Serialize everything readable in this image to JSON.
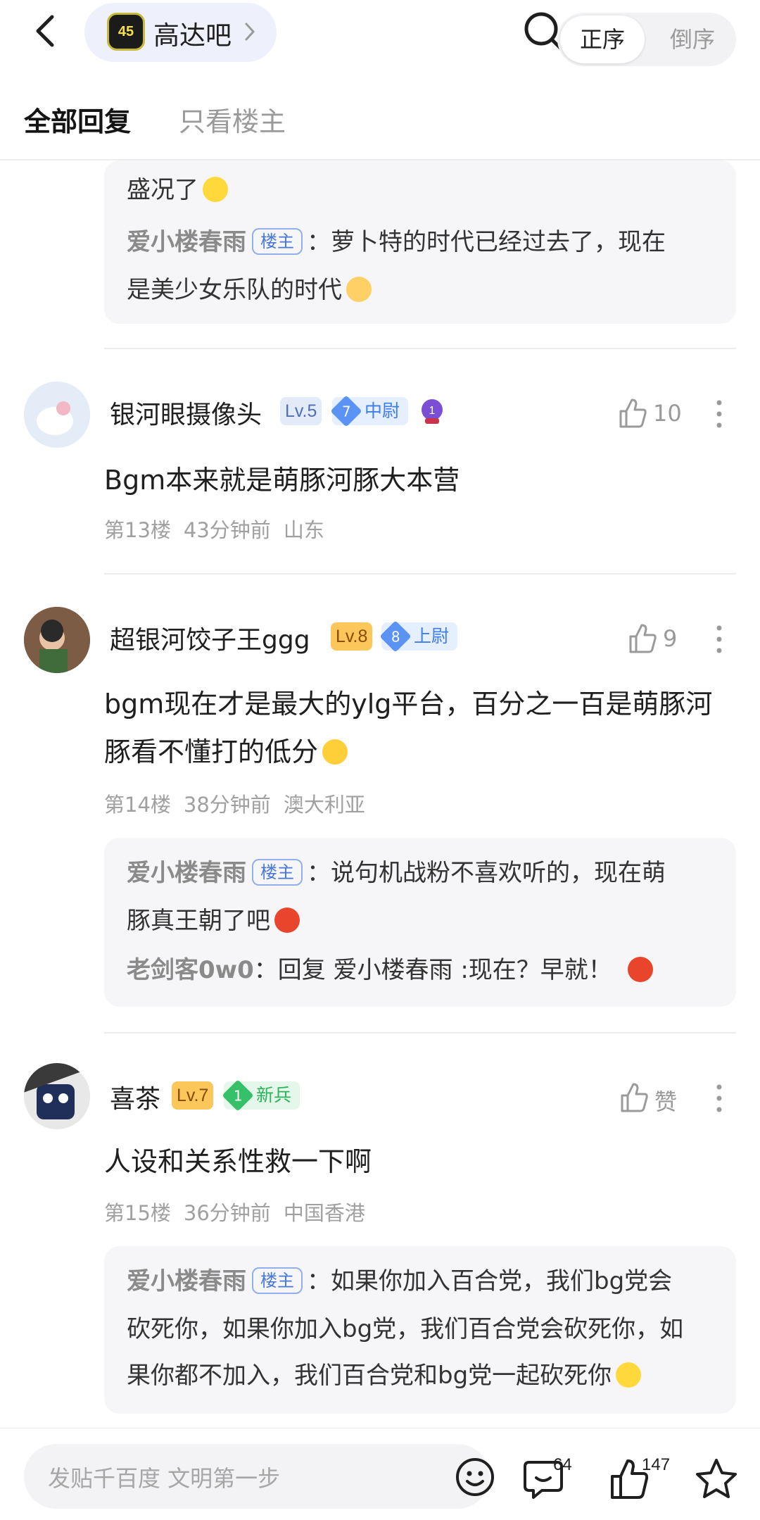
{
  "header": {
    "forum_name": "高达吧",
    "forum_logo_text": "45"
  },
  "tabs": {
    "all": "全部回复",
    "op_only": "只看楼主",
    "order_asc": "正序",
    "order_desc": "倒序"
  },
  "prev_reply": {
    "line1": "盛况了",
    "r2_name": "爱小楼春雨",
    "r2_badge": "楼主",
    "r2_text1": "萝卜特的时代已经过去了，现在",
    "r2_text2": "是美少女乐队的时代"
  },
  "posts": [
    {
      "username": "银河眼摄像头",
      "level": "Lv.5",
      "rank_num": "7",
      "rank_label": "中尉",
      "likes": "10",
      "text": "Bgm本来就是萌豚河豚大本营",
      "floor": "第13楼",
      "time": "43分钟前",
      "location": "山东"
    },
    {
      "username": "超银河饺子王ggg",
      "level": "Lv.8",
      "rank_num": "8",
      "rank_label": "上尉",
      "likes": "9",
      "text1": "bgm现在才是最大的ylg平台，百分之一百是萌豚河",
      "text2": "豚看不懂打的低分",
      "floor": "第14楼",
      "time": "38分钟前",
      "location": "澳大利亚",
      "replies": [
        {
          "name": "爱小楼春雨",
          "badge": "楼主",
          "text1": "说句机战粉不喜欢听的，现在萌",
          "text2": "豚真王朝了吧"
        },
        {
          "name": "老剑客0w0",
          "text": "回复 爱小楼春雨 :现在？早就！"
        }
      ]
    },
    {
      "username": "喜茶",
      "level": "Lv.7",
      "rank_num": "1",
      "rank_label": "新兵",
      "likes": "赞",
      "text": "人设和关系性救一下啊",
      "floor": "第15楼",
      "time": "36分钟前",
      "location": "中国香港",
      "replies": [
        {
          "name": "爱小楼春雨",
          "badge": "楼主",
          "text1": "如果你加入百合党，我们bg党会",
          "text2": "砍死你，如果你加入bg党，我们百合党会砍死你，如",
          "text3": "果你都不加入，我们百合党和bg党一起砍死你"
        }
      ]
    }
  ],
  "bottom": {
    "placeholder": "发贴千百度 文明第一步",
    "comment_count": "64",
    "like_count": "147"
  },
  "colors": {
    "accent_blue": "#4a78d8",
    "level_orange": "#fbc65a",
    "rank_green": "#37c06a",
    "reply_bg": "#f6f6f8"
  }
}
